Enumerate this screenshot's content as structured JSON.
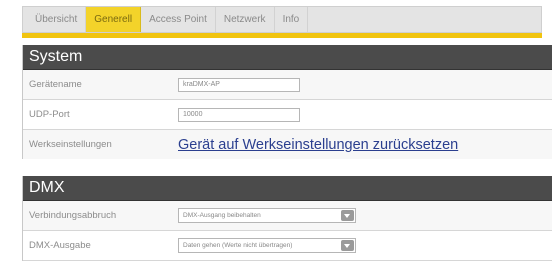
{
  "nav": {
    "tabs": [
      {
        "label": "Übersicht"
      },
      {
        "label": "Generell"
      },
      {
        "label": "Access Point"
      },
      {
        "label": "Netzwerk"
      },
      {
        "label": "Info"
      }
    ],
    "active_tab": "Generell"
  },
  "system": {
    "title": "System",
    "device_name_label": "Gerätename",
    "device_name_value": "kraDMX-AP",
    "udp_port_label": "UDP-Port",
    "udp_port_value": "10000",
    "factory_label": "Werkseinstellungen",
    "factory_link": "Gerät auf Werkseinstellungen zurücksetzen"
  },
  "dmx": {
    "title": "DMX",
    "connection_loss_label": "Verbindungsabbruch",
    "connection_loss_value": "DMX-Ausgang beibehalten",
    "output_label": "DMX-Ausgabe",
    "output_value": "Daten gehen (Werte nicht übertragen)"
  },
  "colors": {
    "accent": "#f1c40f",
    "header_bg": "#4b4b4b",
    "link": "#2b3f8f"
  }
}
